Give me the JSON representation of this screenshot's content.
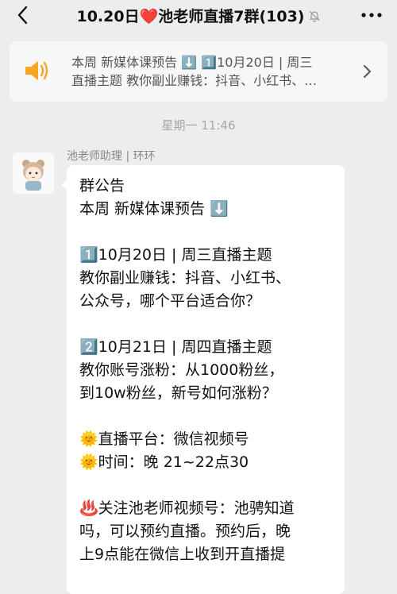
{
  "header": {
    "title": "10.20日❤️池老师直播7群(103)"
  },
  "announcement_bar": {
    "line1": "本周 新媒体课预告 ⬇️ 1️⃣10月20日 | 周三",
    "line2": "直播主题 教你副业赚钱：抖音、小红书、…"
  },
  "timestamp": "星期一 11:46",
  "message": {
    "sender": "池老师助理 | 环环",
    "lines": [
      "群公告",
      "本周 新媒体课预告 ⬇️",
      "",
      "1️⃣10月20日 | 周三直播主题",
      "教你副业赚钱：抖音、小红书、",
      "公众号，哪个平台适合你？",
      "",
      "2️⃣10月21日 | 周四直播主题",
      "教你账号涨粉：从1000粉丝，",
      "到10w粉丝，新号如何涨粉？",
      "",
      "🌞直播平台：微信视频号",
      "🌞时间：晚 21~22点30",
      "",
      "♨️关注池老师视频号：池骋知道",
      "吗，可以预约直播。预约后，晚",
      "上9点能在微信上收到开直播提"
    ]
  }
}
